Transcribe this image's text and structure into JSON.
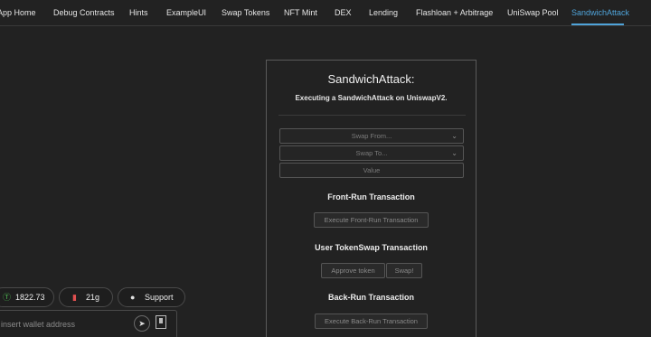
{
  "nav": {
    "items": [
      {
        "label": "App Home"
      },
      {
        "label": "Debug Contracts"
      },
      {
        "label": "Hints"
      },
      {
        "label": "ExampleUI"
      },
      {
        "label": "Swap Tokens"
      },
      {
        "label": "NFT Mint"
      },
      {
        "label": "DEX"
      },
      {
        "label": "Lending"
      },
      {
        "label": "Flashloan + Arbitrage"
      },
      {
        "label": "UniSwap Pool"
      },
      {
        "label": "SandwichAttack"
      }
    ],
    "active": "SandwichAttack",
    "accent_color": "#4fa3d9"
  },
  "card": {
    "title": "SandwichAttack:",
    "subtitle": "Executing a SandwichAttack on UniswapV2.",
    "swap_from_placeholder": "Swap From...",
    "swap_to_placeholder": "Swap To...",
    "value_placeholder": "Value",
    "front_run": {
      "title": "Front-Run Transaction",
      "button": "Execute Front-Run Transaction"
    },
    "user_swap": {
      "title": "User TokenSwap Transaction",
      "approve_button": "Approve token",
      "swap_button": "Swap!"
    },
    "back_run": {
      "title": "Back-Run Transaction",
      "button": "Execute Back-Run Transaction"
    }
  },
  "footer": {
    "eth_price": "1822.73",
    "gas_price": "21g",
    "support_label": "Support",
    "wallet_placeholder": "insert wallet address",
    "icons": {
      "price": "dollar-circle-icon",
      "gas": "gas-pump-icon",
      "support": "chat-bubble-icon",
      "send": "send-icon",
      "scan": "qr-scan-icon"
    },
    "price_icon_color": "#4caf50",
    "gas_icon_color": "#e05050"
  }
}
